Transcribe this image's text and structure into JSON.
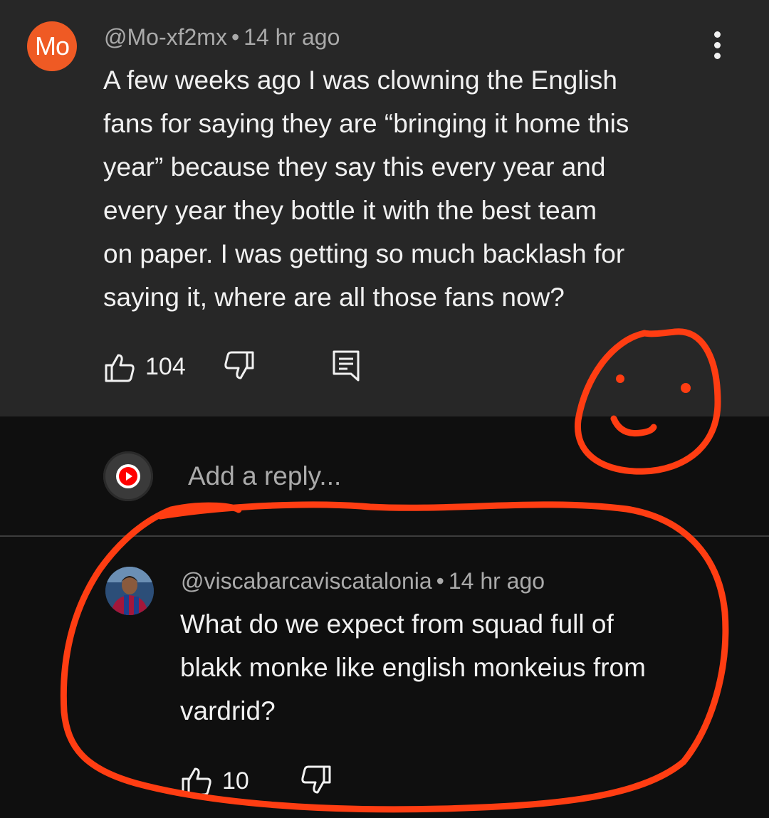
{
  "comment": {
    "avatar_initials": "Mo",
    "author": "@Mo-xf2mx",
    "separator": "•",
    "time": "14 hr ago",
    "text_lines": [
      "A few weeks ago I was clowning the English",
      "fans for saying they are “bringing it home this",
      "year” because they say this every year and",
      "every year they bottle it with the best team",
      "on paper. I was getting so much backlash for",
      "saying it, where are all those fans now?"
    ],
    "likes": "104"
  },
  "reply_input": {
    "placeholder": "Add a reply..."
  },
  "reply": {
    "author": "@viscabarcaviscatalonia",
    "separator": "•",
    "time": "14 hr ago",
    "text_lines": [
      "What do we expect from squad full of",
      "blakk monke like english monkeius from",
      "vardrid?"
    ],
    "likes": "10"
  },
  "colors": {
    "background": "#0f0f0f",
    "comment_card": "#272727",
    "avatar_orange": "#ef5a24",
    "annotation_red": "#ff3d12",
    "youtube_red": "#ff0000",
    "meta_gray": "#aaaaaa"
  },
  "icons": [
    "kebab-menu-icon",
    "thumbs-up-icon",
    "thumbs-down-icon",
    "reply-comment-icon",
    "youtube-logo-icon"
  ]
}
